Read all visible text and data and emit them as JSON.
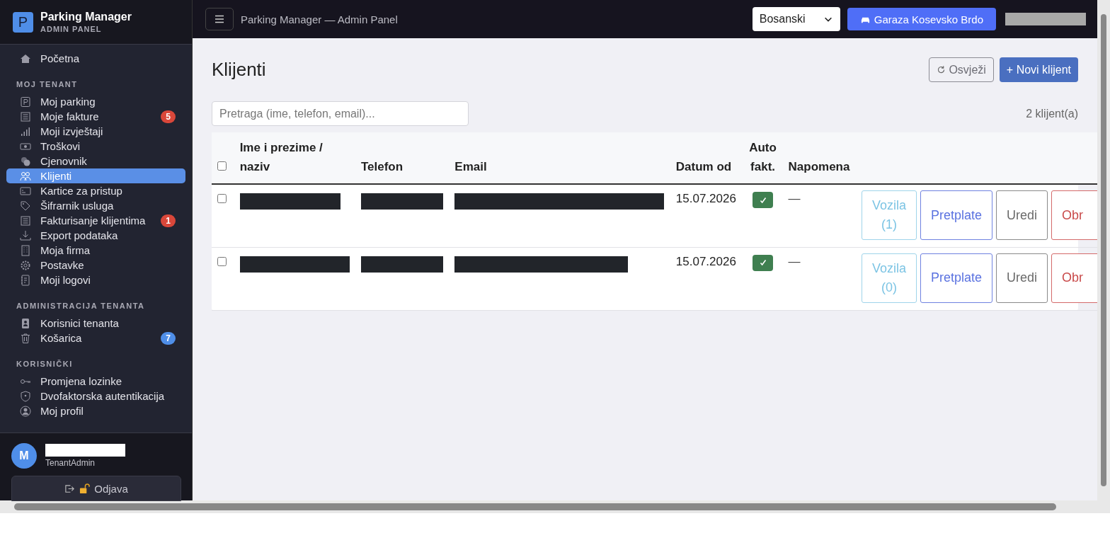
{
  "sidebar": {
    "brand": {
      "logo": "P",
      "title": "Parking Manager",
      "subtitle": "ADMIN PANEL"
    },
    "sections": [
      {
        "items": [
          {
            "label": "Početna",
            "selected": false
          }
        ]
      },
      {
        "title": "MOJ TENANT",
        "items": [
          {
            "label": "Moj parking",
            "selected": false
          },
          {
            "label": "Moje fakture",
            "selected": false,
            "badge": "5",
            "color": "#d9473a"
          },
          {
            "label": "Moji izvještaji",
            "selected": false
          },
          {
            "label": "Troškovi",
            "selected": false
          },
          {
            "label": "Cjenovnik",
            "selected": false
          },
          {
            "label": "Klijenti",
            "selected": true
          },
          {
            "label": "Kartice za pristup",
            "selected": false
          },
          {
            "label": "Šifrarnik usluga",
            "selected": false
          },
          {
            "label": "Fakturisanje klijentima",
            "selected": false,
            "badge": "1",
            "color": "#d9473a"
          },
          {
            "label": "Export podataka",
            "selected": false
          },
          {
            "label": "Moja firma",
            "selected": false
          },
          {
            "label": "Postavke",
            "selected": false
          },
          {
            "label": "Moji logovi",
            "selected": false
          }
        ]
      },
      {
        "title": "ADMINISTRACIJA TENANTA",
        "items": [
          {
            "label": "Korisnici tenanta",
            "selected": false
          },
          {
            "label": "Košarica",
            "selected": false,
            "badge": "7",
            "color": "#4f8ee8"
          }
        ]
      },
      {
        "title": "KORISNIČKI",
        "items": [
          {
            "label": "Promjena lozinke",
            "selected": false
          },
          {
            "label": "Dvofaktorska autentikacija",
            "selected": false
          },
          {
            "label": "Moj profil",
            "selected": false
          }
        ]
      }
    ],
    "user": {
      "initial": "M",
      "role": "TenantAdmin"
    },
    "logout": "Odjava"
  },
  "topbar": {
    "title": "Parking Manager — Admin Panel",
    "language": "Bosanski",
    "garage": "Garaza Kosevsko Brdo"
  },
  "page": {
    "title": "Klijenti",
    "refresh": "Osvježi",
    "new": "+ Novi klijent",
    "search": {
      "placeholder": "Pretraga (ime, telefon, email)..."
    },
    "count": "2 klijent(a)"
  },
  "table": {
    "header_selected": false,
    "columns": [
      "Ime i prezime / naziv",
      "Telefon",
      "Email",
      "Datum od",
      "Auto fakt.",
      "Napomena"
    ],
    "rows": [
      {
        "selected": false,
        "date": "15.07.2026",
        "auto_invoice": true,
        "note": "—",
        "vehicles": "Vozila (1)",
        "subscriptions": "Pretplate",
        "edit": "Uredi",
        "delete": "Obr"
      },
      {
        "selected": false,
        "date": "15.07.2026",
        "auto_invoice": true,
        "note": "—",
        "vehicles": "Vozila (0)",
        "subscriptions": "Pretplate",
        "edit": "Uredi",
        "delete": "Obr"
      }
    ]
  }
}
